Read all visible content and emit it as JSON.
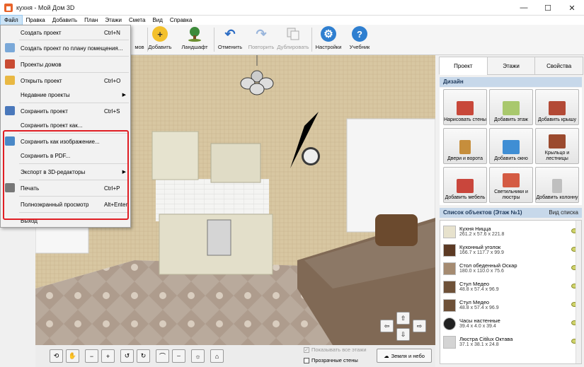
{
  "window": {
    "title": "кухня - Мой Дом 3D",
    "minimize": "—",
    "maximize": "☐",
    "close": "✕"
  },
  "menubar": [
    "Файл",
    "Правка",
    "Добавить",
    "План",
    "Этажи",
    "Смета",
    "Вид",
    "Справка"
  ],
  "toolbar": {
    "walls_partial": "мов",
    "add": "Добавить",
    "landscape": "Ландшафт",
    "undo": "Отменить",
    "redo": "Повторить",
    "duplicate": "Дублировать",
    "settings": "Настройки",
    "tutorial": "Учебник"
  },
  "file_menu": [
    {
      "label": "Создать проект",
      "shortcut": "Ctrl+N"
    },
    {
      "label": "Создать проект по плану помещения...",
      "shortcut": ""
    },
    {
      "label": "Проекты домов",
      "shortcut": ""
    },
    {
      "label": "Открыть проект",
      "shortcut": "Ctrl+O"
    },
    {
      "label": "Недавние проекты",
      "shortcut": ""
    },
    {
      "label": "Сохранить проект",
      "shortcut": "Ctrl+S"
    },
    {
      "label": "Сохранить проект как...",
      "shortcut": ""
    },
    {
      "label": "Сохранить как изображение...",
      "shortcut": ""
    },
    {
      "label": "Сохранить в  PDF...",
      "shortcut": ""
    },
    {
      "label": "Экспорт в 3D-редакторы",
      "shortcut": ""
    },
    {
      "label": "Печать",
      "shortcut": "Ctrl+P"
    },
    {
      "label": "Полноэкранный просмотр",
      "shortcut": "Alt+Enter"
    },
    {
      "label": "Выход",
      "shortcut": ""
    }
  ],
  "submenu_arrow": "▶",
  "panel": {
    "tabs": [
      "Проект",
      "Этажи",
      "Свойства"
    ],
    "design_header": "Дизайн",
    "tiles": [
      "Нарисовать стены",
      "Добавить этаж",
      "Добавить крышу",
      "Двери и ворота",
      "Добавить окно",
      "Крыльцо и лестницы",
      "Добавить мебель",
      "Светильники и люстры",
      "Добавить колонну"
    ],
    "list_header": "Список объектов (Этаж №1)",
    "list_view": "Вид списка",
    "objects": [
      {
        "name": "Кухня Ницца",
        "size": "261.2 x 57.6 x 221.8"
      },
      {
        "name": "Кухонный уголок",
        "size": "166.7 x 117.7 x 99.9"
      },
      {
        "name": "Стол обеденный Оскар",
        "size": "180.0 x 110.0 x 75.6"
      },
      {
        "name": "Стул Медео",
        "size": "48.8 x 57.4 x 96.9"
      },
      {
        "name": "Стул Медео",
        "size": "48.8 x 57.4 x 96.9"
      },
      {
        "name": "Часы настенные",
        "size": "39.4 x 4.0 x 39.4"
      },
      {
        "name": "Люстра Citilux Октава",
        "size": "37.1 x 38.1 x 24.8"
      }
    ]
  },
  "viewport": {
    "show_all_floors": "Показывать все этажи",
    "transparent_walls": "Прозрачные стены",
    "earth_sky": "Земля и небо",
    "nav_glyphs": [
      "⇧",
      "⇦",
      "⇨",
      "⇩"
    ]
  },
  "colors": {
    "accent_red": "#e01e24",
    "header_blue": "#c7d8ea",
    "menu_highlight": "#cce4f7"
  }
}
